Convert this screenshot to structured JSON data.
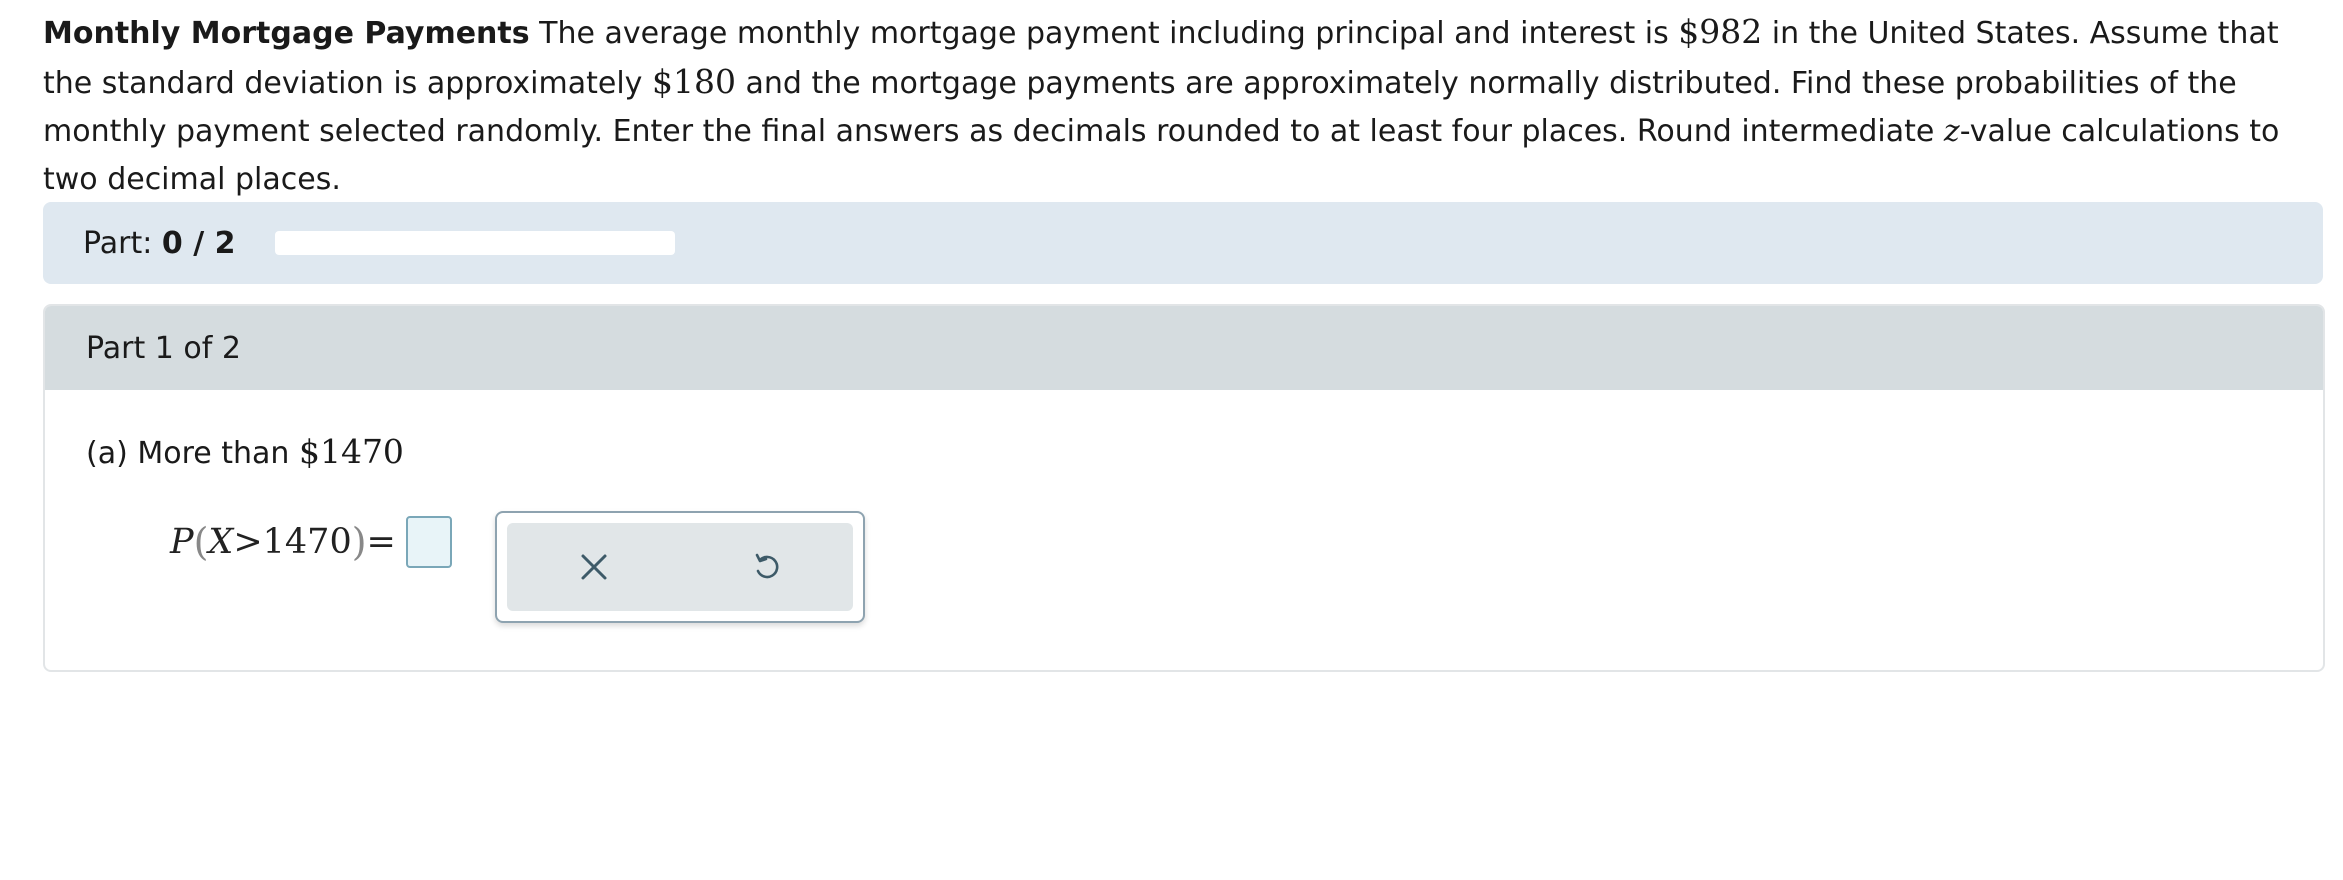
{
  "problem": {
    "title": "Monthly Mortgage Payments",
    "text_1": " The average monthly mortgage payment including principal and interest is ",
    "mean": "$982",
    "text_2": " in the United States. Assume that the standard deviation is approximately ",
    "sd": "$180",
    "text_3": " and the mortgage payments are approximately normally distributed. Find these probabilities of the monthly payment selected randomly. Enter the final answers as decimals rounded to at least four places. Round intermediate ",
    "z": "z",
    "text_4": "-value calculations to two decimal places."
  },
  "progress": {
    "label": "Part:",
    "value": "0 / 2",
    "fraction": 0
  },
  "part": {
    "header": "Part 1 of 2",
    "question_prefix": "(a) More than ",
    "question_amount": "$1470",
    "equation": {
      "p": "P",
      "open": "(",
      "var": "X",
      "op": ">",
      "num": "1470",
      "close": ")",
      "eq": "="
    },
    "answer_value": ""
  },
  "tools": {
    "clear_icon": "close-icon",
    "undo_icon": "undo-icon"
  },
  "colors": {
    "part_bar_bg": "#dfe8f0",
    "header_bg": "#d5dcdf",
    "answer_border": "#7aa7b8",
    "icon_color": "#3d5a68"
  }
}
